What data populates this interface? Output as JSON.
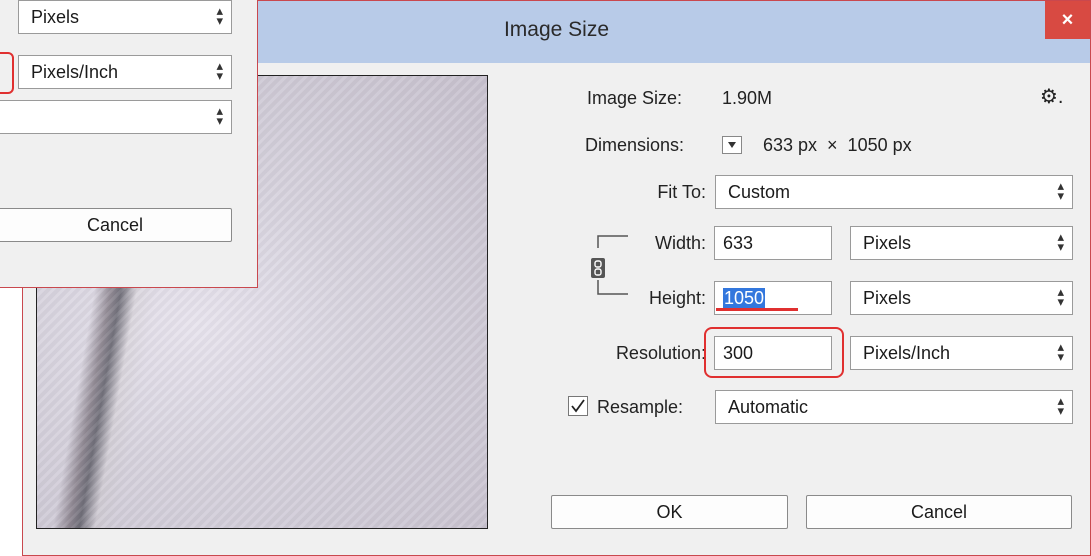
{
  "background_dialog": {
    "unit1": "Pixels",
    "unit2": "Pixels/Inch",
    "unit3": "",
    "cancel": "Cancel"
  },
  "dialog": {
    "title": "Image Size",
    "close": "×",
    "image_size_label": "Image Size:",
    "image_size_value": "1.90M",
    "gear": "⚙.",
    "dimensions_label": "Dimensions:",
    "dimensions_value": "633 px  ×  1050 px",
    "fit_to_label": "Fit To:",
    "fit_to_value": "Custom",
    "width_label": "Width:",
    "width_value": "633",
    "width_unit": "Pixels",
    "height_label": "Height:",
    "height_value": "1050",
    "height_unit": "Pixels",
    "resolution_label": "Resolution:",
    "resolution_value": "300",
    "resolution_unit": "Pixels/Inch",
    "resample_label": "Resample:",
    "resample_checked": true,
    "resample_value": "Automatic",
    "ok": "OK",
    "cancel": "Cancel"
  },
  "colors": {
    "titlebar": "#b8cbe8",
    "close": "#d84a42",
    "highlight": "#e03030",
    "selection": "#3377dd"
  },
  "icons": [
    "close-icon",
    "gear-icon",
    "dropdown-icon",
    "link-chain-icon",
    "checkbox-check-icon"
  ]
}
